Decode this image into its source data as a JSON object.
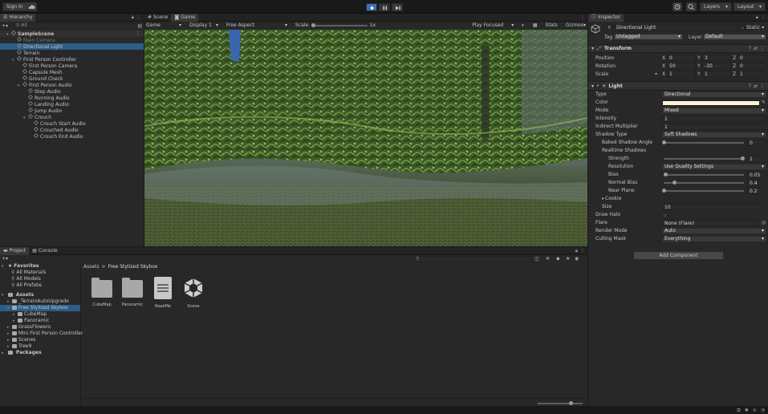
{
  "toolbar": {
    "sign_in": "Sign In",
    "layers": "Layers",
    "layout": "Layout"
  },
  "hierarchy": {
    "tab": "Hierarchy",
    "search_placeholder": "All",
    "items": [
      {
        "label": "SampleScene",
        "depth": 0
      },
      {
        "label": "Main Camera",
        "depth": 1,
        "disabled": true
      },
      {
        "label": "Directional Light",
        "depth": 1,
        "selected": true
      },
      {
        "label": "Terrain",
        "depth": 1
      },
      {
        "label": "First Person Controller",
        "depth": 1
      },
      {
        "label": "First Person Camera",
        "depth": 2
      },
      {
        "label": "Capsule Mesh",
        "depth": 2
      },
      {
        "label": "Ground Check",
        "depth": 2
      },
      {
        "label": "First Person Audio",
        "depth": 2
      },
      {
        "label": "Step Audio",
        "depth": 3
      },
      {
        "label": "Running Audio",
        "depth": 3
      },
      {
        "label": "Landing Audio",
        "depth": 3
      },
      {
        "label": "Jump Audio",
        "depth": 3
      },
      {
        "label": "Crouch",
        "depth": 3
      },
      {
        "label": "Crouch Start Audio",
        "depth": 4
      },
      {
        "label": "Crouched Audio",
        "depth": 4
      },
      {
        "label": "Crouch End Audio",
        "depth": 4
      }
    ]
  },
  "game_view": {
    "tab_scene": "Scene",
    "tab_game": "Game",
    "game_dropdown": "Game",
    "display": "Display 1",
    "aspect": "Free Aspect",
    "scale_label": "Scale",
    "scale_value": "1x",
    "play_focused": "Play Focused",
    "stats": "Stats",
    "gizmos": "Gizmos"
  },
  "inspector": {
    "tab": "Inspector",
    "object_name": "Directional Light",
    "static": "Static",
    "tag_label": "Tag",
    "tag_value": "Untagged",
    "layer_label": "Layer",
    "layer_value": "Default",
    "transform": {
      "title": "Transform",
      "position_label": "Position",
      "position": [
        "0",
        "3",
        "0"
      ],
      "rotation_label": "Rotation",
      "rotation": [
        "50",
        "-30",
        "0"
      ],
      "scale_label": "Scale",
      "scale": [
        "1",
        "1",
        "1"
      ]
    },
    "light": {
      "title": "Light",
      "type_label": "Type",
      "type": "Directional",
      "color_label": "Color",
      "color_hex": "#fdf1d8",
      "mode_label": "Mode",
      "mode": "Mixed",
      "intensity_label": "Intensity",
      "intensity": "1",
      "indirect_label": "Indirect Multiplier",
      "indirect": "1",
      "shadow_type_label": "Shadow Type",
      "shadow_type": "Soft Shadows",
      "baked_angle_label": "Baked Shadow Angle",
      "baked_angle": "0",
      "realtime_label": "Realtime Shadows",
      "strength_label": "Strength",
      "strength": "1",
      "resolution_label": "Resolution",
      "resolution": "Use Quality Settings",
      "bias_label": "Bias",
      "bias": "0.05",
      "normal_bias_label": "Normal Bias",
      "normal_bias": "0.4",
      "near_plane_label": "Near Plane",
      "near_plane": "0.2",
      "cookie_label": "Cookie",
      "size_label": "Size",
      "size": "10",
      "draw_halo_label": "Draw Halo",
      "flare_label": "Flare",
      "flare": "None (Flare)",
      "render_mode_label": "Render Mode",
      "render_mode": "Auto",
      "culling_label": "Culling Mask",
      "culling": "Everything"
    },
    "add_component": "Add Component"
  },
  "project": {
    "tab_project": "Project",
    "tab_console": "Console",
    "breadcrumb_root": "Assets",
    "breadcrumb_sep": ">",
    "breadcrumb_current": "Free Stylized Skybox",
    "favorites": {
      "label": "Favorites",
      "items": [
        "All Materials",
        "All Models",
        "All Prefabs"
      ]
    },
    "assets_label": "Assets",
    "tree": [
      {
        "label": "_TerrainAutoUpgrade",
        "depth": 1
      },
      {
        "label": "Free Stylized Skybox",
        "depth": 1,
        "selected": true,
        "open": true
      },
      {
        "label": "CubeMap",
        "depth": 2
      },
      {
        "label": "Panoramic",
        "depth": 2
      },
      {
        "label": "GrassFlowers",
        "depth": 1
      },
      {
        "label": "Mini First Person Controller",
        "depth": 1
      },
      {
        "label": "Scenes",
        "depth": 1
      },
      {
        "label": "Tree9",
        "depth": 1
      }
    ],
    "packages_label": "Packages",
    "assets": [
      {
        "label": "CubeMap",
        "kind": "folder"
      },
      {
        "label": "Panoramic",
        "kind": "folder"
      },
      {
        "label": "ReadMe",
        "kind": "document"
      },
      {
        "label": "Scene",
        "kind": "unity-scene"
      }
    ]
  }
}
